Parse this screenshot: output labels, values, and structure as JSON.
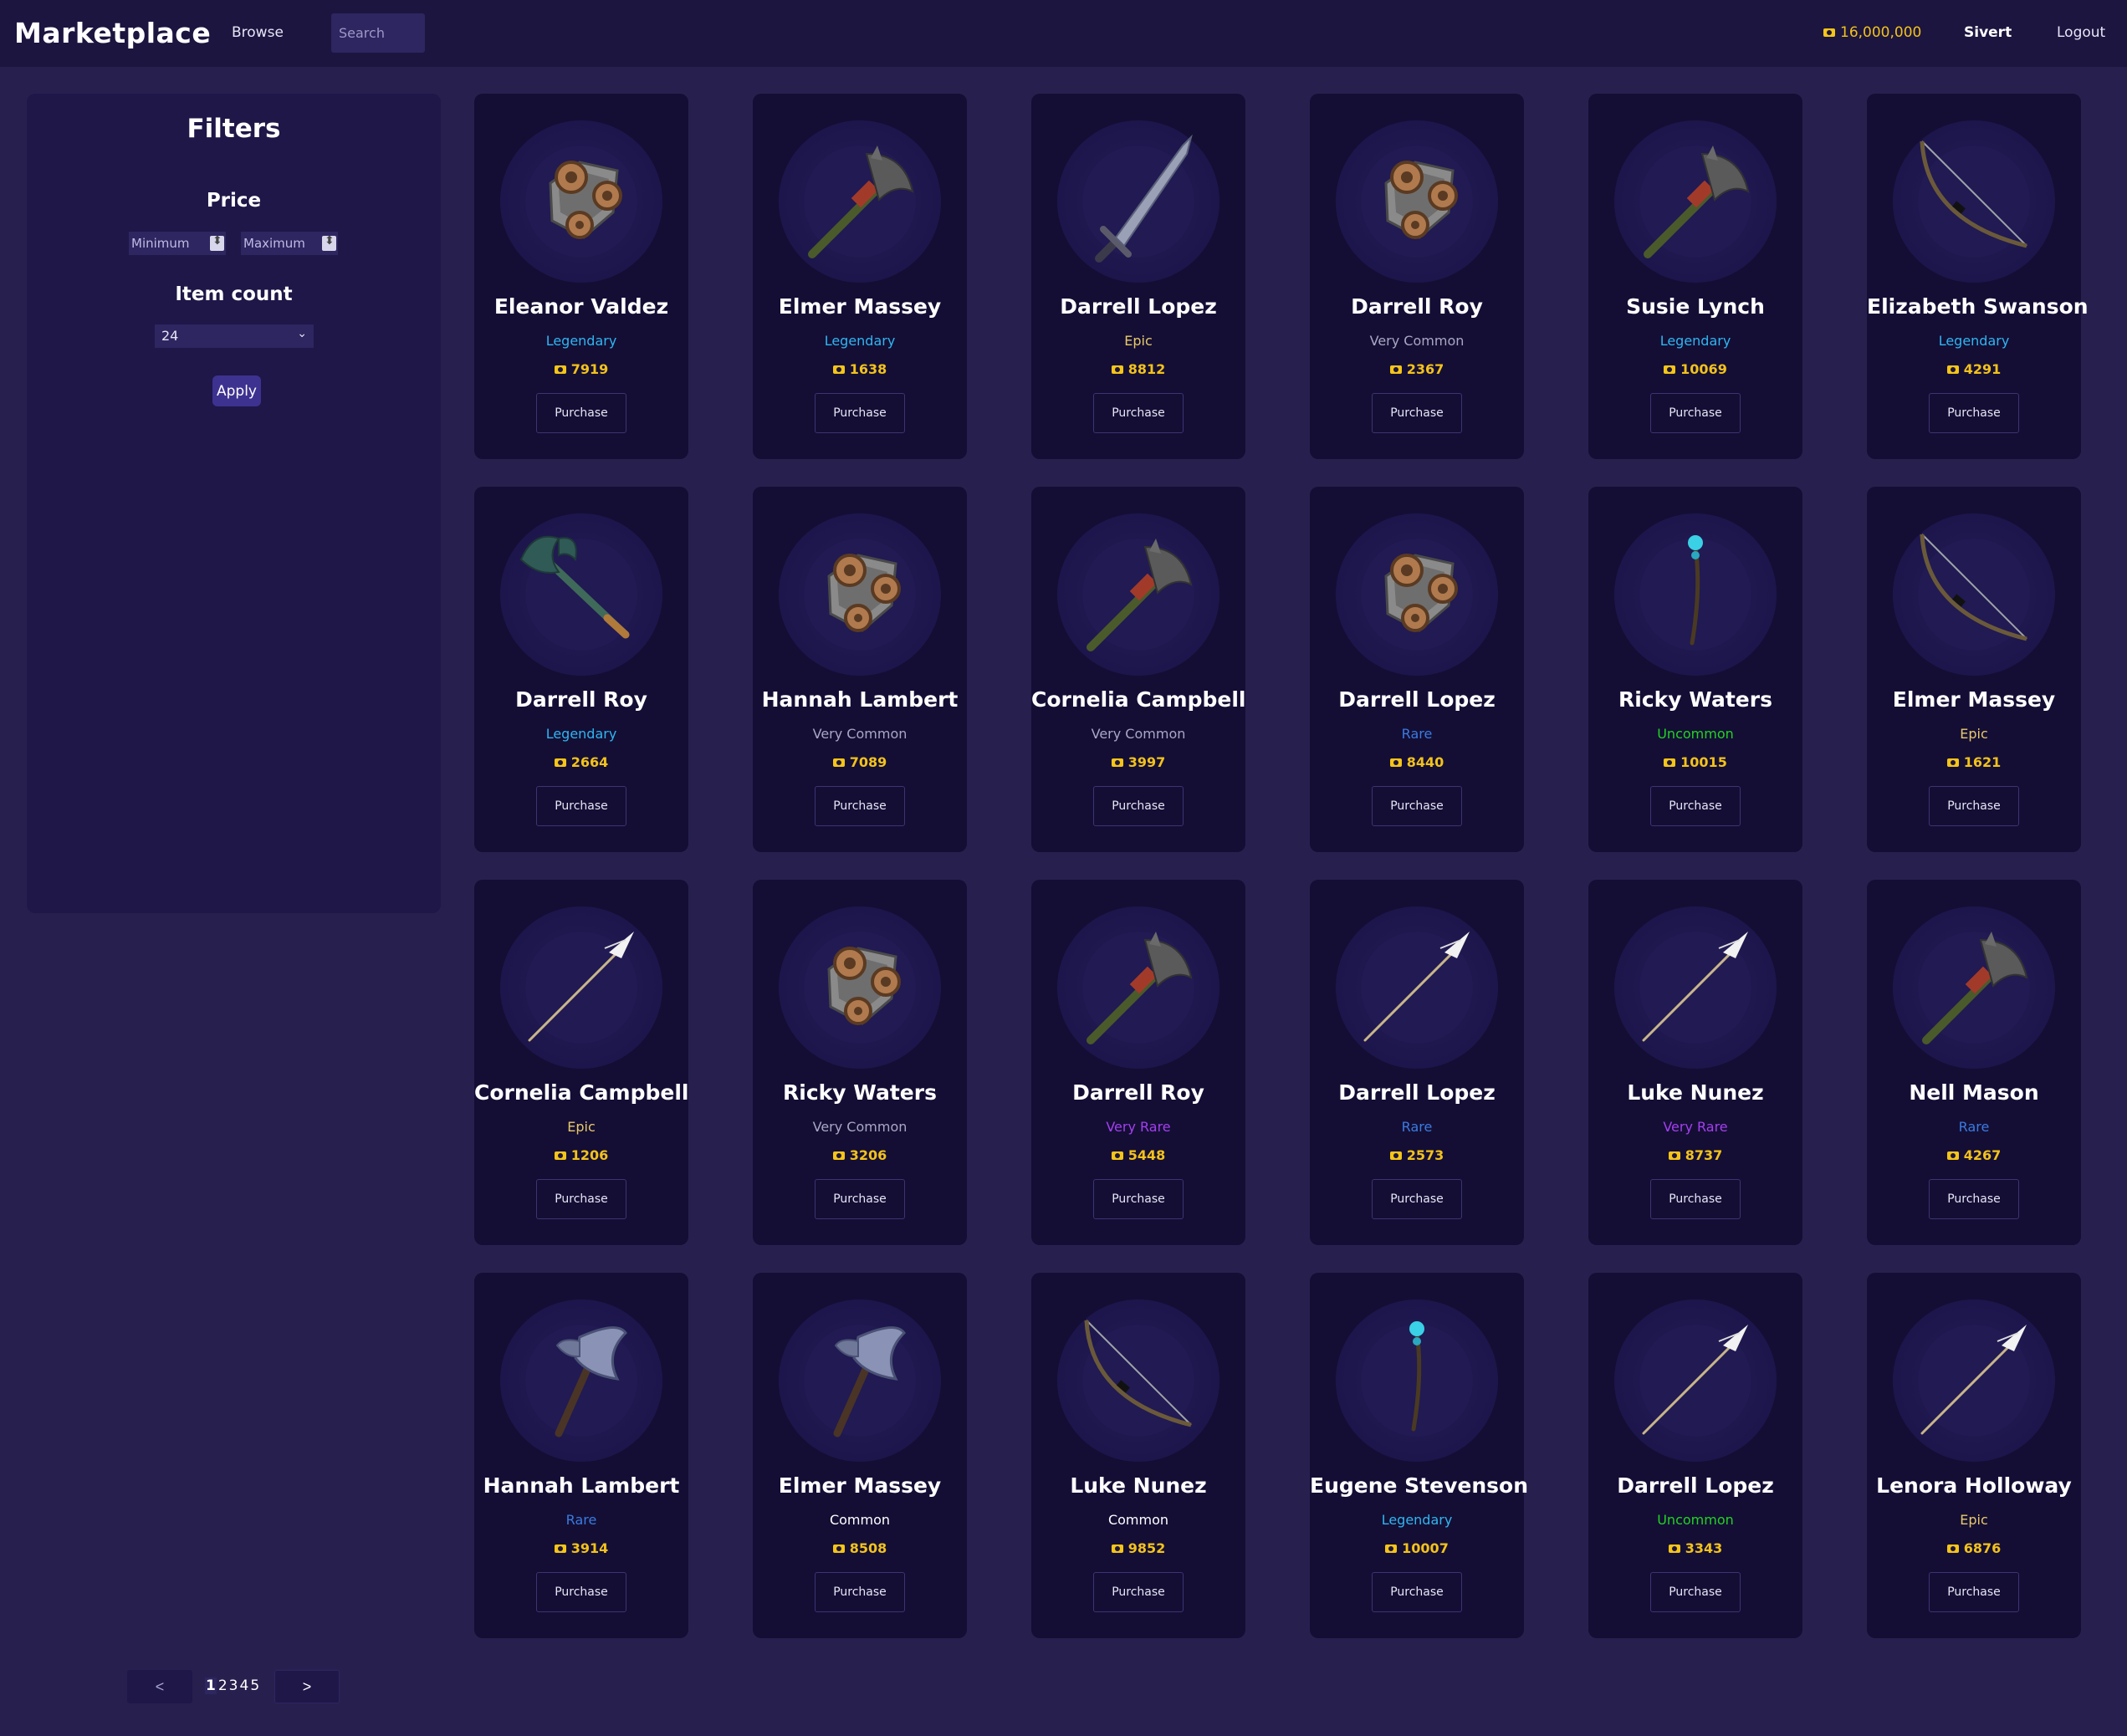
{
  "header": {
    "brand": "Marketplace",
    "browse": "Browse",
    "search_placeholder": "Search",
    "balance": "16,000,000",
    "username": "Sivert",
    "logout": "Logout"
  },
  "filters": {
    "title": "Filters",
    "price_label": "Price",
    "min_placeholder": "Minimum",
    "max_placeholder": "Maximum",
    "separator": "~",
    "count_label": "Item count",
    "count_value": "24",
    "apply": "Apply"
  },
  "colors": {
    "legendary": "#2fb6f0",
    "epic": "#e8c96a",
    "very_common": "#a9a7c4",
    "rare": "#3a7be0",
    "uncommon": "#21d321",
    "very_rare": "#a43ff0",
    "common": "#ffffff",
    "gold": "#f2c21b"
  },
  "purchase_label": "Purchase",
  "cards": [
    {
      "name": "Eleanor Valdez",
      "rarity": "Legendary",
      "rarity_key": "legendary",
      "price": "7919",
      "icon": "gear-shield-icon"
    },
    {
      "name": "Elmer Massey",
      "rarity": "Legendary",
      "rarity_key": "legendary",
      "price": "1638",
      "icon": "axe-icon"
    },
    {
      "name": "Darrell Lopez",
      "rarity": "Epic",
      "rarity_key": "epic",
      "price": "8812",
      "icon": "sword-icon"
    },
    {
      "name": "Darrell Roy",
      "rarity": "Very Common",
      "rarity_key": "very_common",
      "price": "2367",
      "icon": "gear-shield-icon"
    },
    {
      "name": "Susie Lynch",
      "rarity": "Legendary",
      "rarity_key": "legendary",
      "price": "10069",
      "icon": "axe-icon"
    },
    {
      "name": "Elizabeth Swanson",
      "rarity": "Legendary",
      "rarity_key": "legendary",
      "price": "4291",
      "icon": "bow-icon"
    },
    {
      "name": "Darrell Roy",
      "rarity": "Legendary",
      "rarity_key": "legendary",
      "price": "2664",
      "icon": "teal-axe-icon"
    },
    {
      "name": "Hannah Lambert",
      "rarity": "Very Common",
      "rarity_key": "very_common",
      "price": "7089",
      "icon": "gear-shield-icon"
    },
    {
      "name": "Cornelia Campbell",
      "rarity": "Very Common",
      "rarity_key": "very_common",
      "price": "3997",
      "icon": "axe-icon"
    },
    {
      "name": "Darrell Lopez",
      "rarity": "Rare",
      "rarity_key": "rare",
      "price": "8440",
      "icon": "gear-shield-icon"
    },
    {
      "name": "Ricky Waters",
      "rarity": "Uncommon",
      "rarity_key": "uncommon",
      "price": "10015",
      "icon": "staff-icon"
    },
    {
      "name": "Elmer Massey",
      "rarity": "Epic",
      "rarity_key": "epic",
      "price": "1621",
      "icon": "bow-icon"
    },
    {
      "name": "Cornelia Campbell",
      "rarity": "Epic",
      "rarity_key": "epic",
      "price": "1206",
      "icon": "spear-icon"
    },
    {
      "name": "Ricky Waters",
      "rarity": "Very Common",
      "rarity_key": "very_common",
      "price": "3206",
      "icon": "gear-shield-icon"
    },
    {
      "name": "Darrell Roy",
      "rarity": "Very Rare",
      "rarity_key": "very_rare",
      "price": "5448",
      "icon": "axe-icon"
    },
    {
      "name": "Darrell Lopez",
      "rarity": "Rare",
      "rarity_key": "rare",
      "price": "2573",
      "icon": "spear-icon"
    },
    {
      "name": "Luke Nunez",
      "rarity": "Very Rare",
      "rarity_key": "very_rare",
      "price": "8737",
      "icon": "spear-icon"
    },
    {
      "name": "Nell Mason",
      "rarity": "Rare",
      "rarity_key": "rare",
      "price": "4267",
      "icon": "axe-icon"
    },
    {
      "name": "Hannah Lambert",
      "rarity": "Rare",
      "rarity_key": "rare",
      "price": "3914",
      "icon": "steel-axe-icon"
    },
    {
      "name": "Elmer Massey",
      "rarity": "Common",
      "rarity_key": "common",
      "price": "8508",
      "icon": "steel-axe-icon"
    },
    {
      "name": "Luke Nunez",
      "rarity": "Common",
      "rarity_key": "common",
      "price": "9852",
      "icon": "bow-icon"
    },
    {
      "name": "Eugene Stevenson",
      "rarity": "Legendary",
      "rarity_key": "legendary",
      "price": "10007",
      "icon": "staff-icon"
    },
    {
      "name": "Darrell Lopez",
      "rarity": "Uncommon",
      "rarity_key": "uncommon",
      "price": "3343",
      "icon": "spear-icon"
    },
    {
      "name": "Lenora Holloway",
      "rarity": "Epic",
      "rarity_key": "epic",
      "price": "6876",
      "icon": "spear-icon"
    }
  ],
  "pagination": {
    "prev": "<",
    "next": ">",
    "pages": [
      "1",
      "2",
      "3",
      "4",
      "5"
    ],
    "current": "1"
  }
}
